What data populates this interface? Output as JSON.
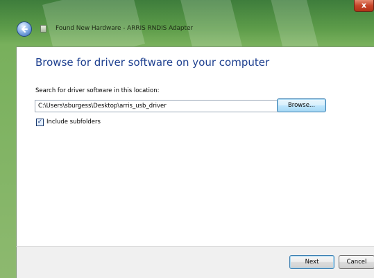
{
  "window": {
    "title": "Found New Hardware - ARRIS RNDIS Adapter",
    "close_glyph": "x"
  },
  "main": {
    "heading": "Browse for driver software on your computer",
    "search_label": "Search for driver software in this location:",
    "path_value": "C:\\Users\\sburgess\\Desktop\\arris_usb_driver",
    "browse_label": "Browse...",
    "include_subfolders_label": "Include subfolders",
    "include_subfolders_checked": true,
    "checkmark": "✓"
  },
  "footer": {
    "next_label": "Next",
    "cancel_label": "Cancel"
  },
  "icons": {
    "back": "back-arrow-icon",
    "wizard": "hardware-wizard-icon"
  },
  "colors": {
    "heading": "#1d3f8f",
    "frame_glass": "#78b05c",
    "close_button": "#c7472b"
  }
}
